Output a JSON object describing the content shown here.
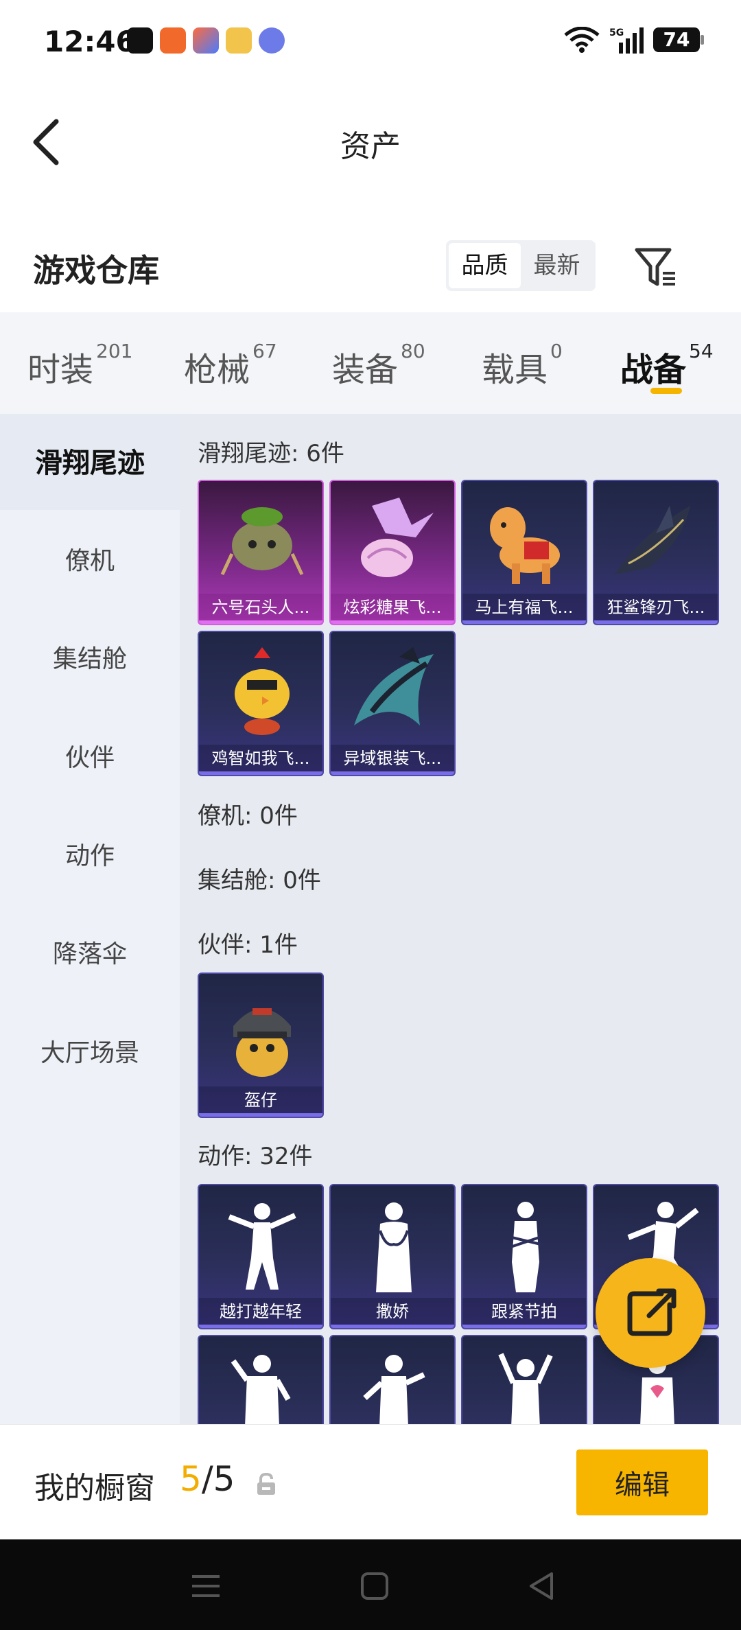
{
  "status": {
    "time": "12:46",
    "network": "5G",
    "battery": "74"
  },
  "header": {
    "title": "资产"
  },
  "warehouse": {
    "title": "游戏仓库",
    "sort_options": [
      "品质",
      "最新"
    ],
    "sort_active": "品质"
  },
  "tabs": [
    {
      "label": "时装",
      "count": "201"
    },
    {
      "label": "枪械",
      "count": "67"
    },
    {
      "label": "装备",
      "count": "80"
    },
    {
      "label": "载具",
      "count": "0"
    },
    {
      "label": "战备",
      "count": "54"
    }
  ],
  "active_tab": "战备",
  "sidebar": {
    "items": [
      "滑翔尾迹",
      "僚机",
      "集结舱",
      "伙伴",
      "动作",
      "降落伞",
      "大厅场景"
    ],
    "active": "滑翔尾迹"
  },
  "sections": {
    "glide": {
      "title": "滑翔尾迹: 6件",
      "items": [
        "六号石头人...",
        "炫彩糖果飞...",
        "马上有福飞...",
        "狂鲨锋刃飞...",
        "鸡智如我飞...",
        "异域银装飞..."
      ]
    },
    "wingman": {
      "title": "僚机: 0件"
    },
    "rally": {
      "title": "集结舱: 0件"
    },
    "partner": {
      "title": "伙伴: 1件",
      "items": [
        "盔仔"
      ]
    },
    "emote": {
      "title": "动作: 32件",
      "items": [
        "越打越年轻",
        "撒娇",
        "跟紧节拍",
        "",
        "",
        "",
        "",
        ""
      ]
    }
  },
  "showcase": {
    "label": "我的橱窗",
    "current": "5",
    "total": "/5",
    "edit_label": "编辑"
  },
  "colors": {
    "accent": "#f7b500",
    "rare_purple": "#7a6ee8",
    "epic_pink": "#d35ee0"
  }
}
